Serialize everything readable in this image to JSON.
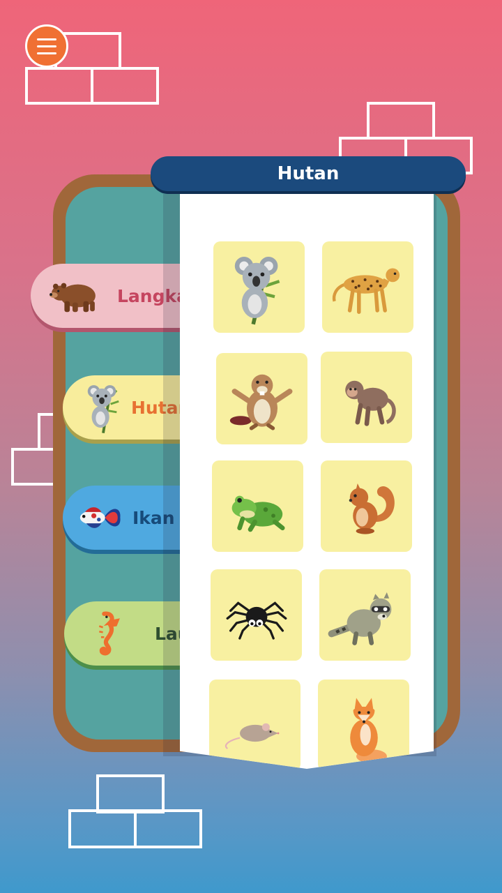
{
  "panel": {
    "title": "Hutan"
  },
  "categories": [
    {
      "id": "langka",
      "label": "Langka",
      "icon": "bear-icon"
    },
    {
      "id": "hutan",
      "label": "Hutan",
      "icon": "koala-icon"
    },
    {
      "id": "ikan",
      "label": "Ikan H",
      "icon": "betta-fish-icon"
    },
    {
      "id": "laut",
      "label": "Laut",
      "icon": "seahorse-icon"
    }
  ],
  "animals": [
    {
      "name": "koala",
      "icon": "koala-icon"
    },
    {
      "name": "cheetah",
      "icon": "cheetah-icon"
    },
    {
      "name": "beaver",
      "icon": "beaver-icon"
    },
    {
      "name": "monkey",
      "icon": "monkey-icon"
    },
    {
      "name": "frog",
      "icon": "frog-icon"
    },
    {
      "name": "squirrel",
      "icon": "squirrel-icon"
    },
    {
      "name": "spider",
      "icon": "spider-icon"
    },
    {
      "name": "raccoon",
      "icon": "raccoon-icon"
    },
    {
      "name": "mouse",
      "icon": "mouse-icon"
    },
    {
      "name": "fox",
      "icon": "fox-icon"
    }
  ],
  "colors": {
    "title_bar": "#1b4a7d",
    "tile": "#f8f0a1",
    "menu": "#f07033",
    "board_frame": "#a0673a",
    "board_inner": "#55a3a0"
  }
}
